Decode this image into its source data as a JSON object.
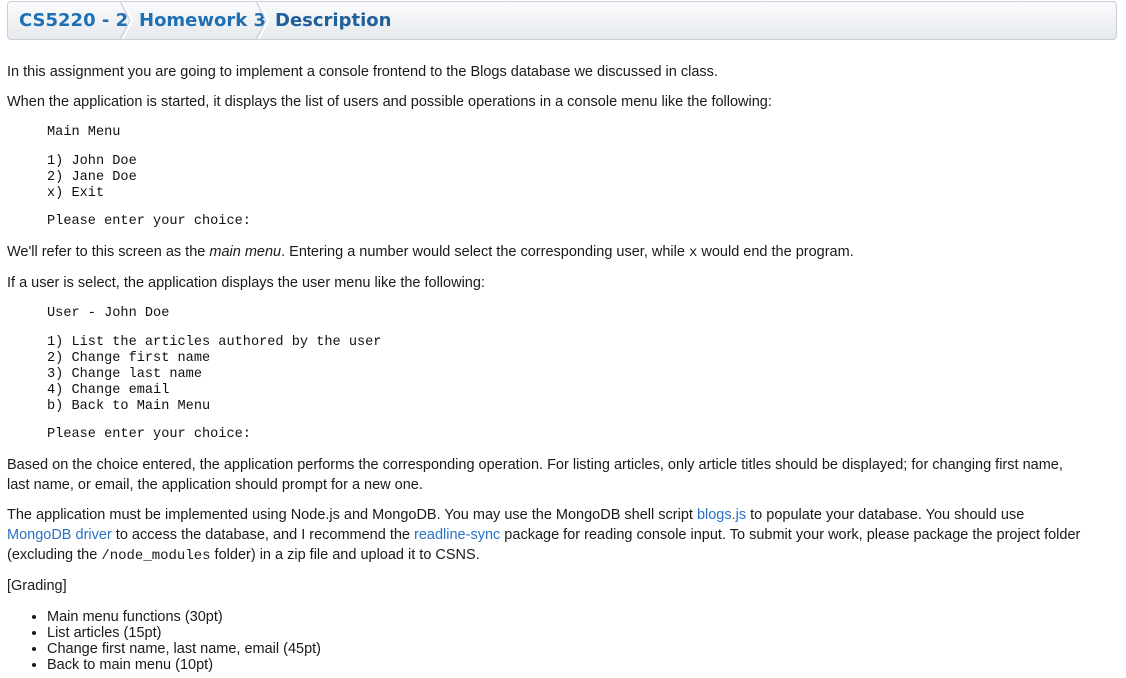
{
  "breadcrumb": {
    "items": [
      {
        "label": "CS5220 - 2"
      },
      {
        "label": "Homework 3"
      },
      {
        "label": "Description"
      }
    ]
  },
  "content": {
    "intro": "In this assignment you are going to implement a console frontend to the Blogs database we discussed in class.",
    "started": "When the application is started, it displays the list of users and possible operations in a console menu like the following:",
    "main_menu": {
      "title": "Main Menu",
      "items": [
        "1) John Doe",
        "2) Jane Doe",
        "x) Exit"
      ],
      "prompt": "Please enter your choice:"
    },
    "refer": {
      "pre": "We'll refer to this screen as the ",
      "em": "main menu",
      "mid": ". Entering a number would select the corresponding user, while ",
      "code": "x",
      "post": " would end the program."
    },
    "if_user": "If a user is select, the application displays the user menu like the following:",
    "user_menu": {
      "title": "User - John Doe",
      "items": [
        "1) List the articles authored by the user",
        "2) Change first name",
        "3) Change last name",
        "4) Change email",
        "b) Back to Main Menu"
      ],
      "prompt": "Please enter your choice:"
    },
    "based": {
      "line1": "Based on the choice entered, the application performs the corresponding operation. For listing articles, only article titles should be displayed; for changing first name,",
      "line2": "last name, or email, the application should prompt for a new one."
    },
    "impl": {
      "t1": "The application must be implemented using Node.js and MongoDB. You may use the MongoDB shell script ",
      "link_blogs": "blogs.js",
      "t2": " to populate your database. You should use",
      "link_driver": "MongoDB driver",
      "t3": " to access the database, and I recommend the ",
      "link_readline": "readline-sync",
      "t4": " package for reading console input. To submit your work, please package the project folder",
      "t5": "(excluding the ",
      "code": "/node_modules",
      "t6": " folder) in a zip file and upload it to CSNS."
    },
    "grading_label": "[Grading]",
    "grading_items": [
      "Main menu functions (30pt)",
      "List articles (15pt)",
      "Change first name, last name, email (45pt)",
      "Back to main menu (10pt)"
    ]
  }
}
